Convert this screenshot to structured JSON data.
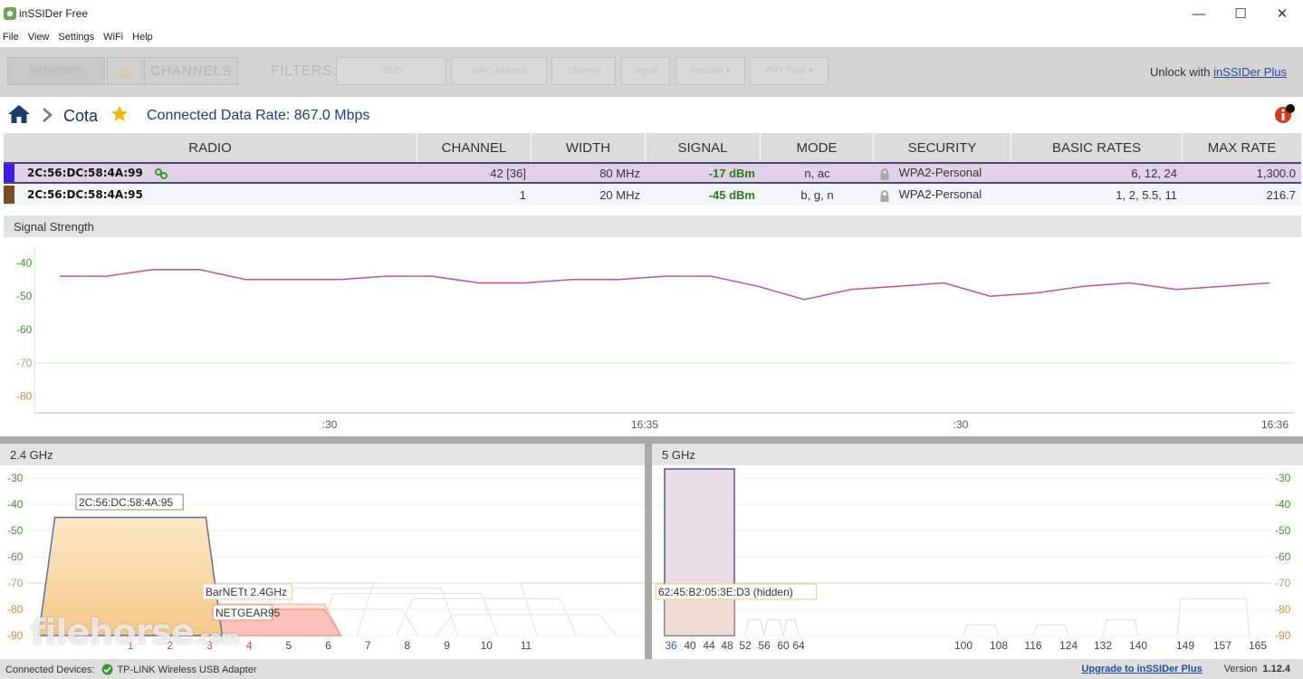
{
  "app": {
    "title": "inSSIDer Free",
    "window_controls": {
      "minimize": "—",
      "maximize": "☐",
      "close": "✕"
    }
  },
  "menu": [
    "File",
    "View",
    "Settings",
    "WiFi",
    "Help"
  ],
  "toolbar": {
    "networks_label": "NETWORKS",
    "channels_label": "CHANNELS",
    "filters_label": "FILTERS:",
    "filters": [
      "SSID",
      "MAC address",
      "Channel",
      "Signal",
      "Security ▾",
      "PHY Type ▾"
    ],
    "unlock_prefix": "Unlock with",
    "unlock_link": "inSSIDer Plus"
  },
  "breadcrumb": {
    "network": "Cota",
    "connected_rate": "Connected Data Rate: 867.0 Mbps"
  },
  "table": {
    "headers": [
      "RADIO",
      "CHANNEL",
      "WIDTH",
      "SIGNAL",
      "MODE",
      "SECURITY",
      "BASIC RATES",
      "MAX RATE"
    ],
    "rows": [
      {
        "color": "#3b1fe6",
        "radio": "2C:56:DC:58:4A:99",
        "channel": "42 [36]",
        "width": "80 MHz",
        "signal": "-17 dBm",
        "mode": "n, ac",
        "security": "WPA2-Personal",
        "basic_rates": "6, 12, 24",
        "max_rate": "1,300.0"
      },
      {
        "color": "#7a4a22",
        "radio": "2C:56:DC:58:4A:95",
        "channel": "1",
        "width": "20 MHz",
        "signal": "-45 dBm",
        "mode": "b, g, n",
        "security": "WPA2-Personal",
        "basic_rates": "1, 2, 5.5, 11",
        "max_rate": "216.7"
      }
    ]
  },
  "signal_strength": {
    "title": "Signal Strength",
    "y_ticks": [
      "-40",
      "-50",
      "-60",
      "-70",
      "-80"
    ],
    "x_ticks": [
      ":30",
      "16:35",
      ":30",
      "16:36"
    ],
    "line_color": "#c2528e",
    "series": [
      -44,
      -44,
      -42,
      -42,
      -45,
      -45,
      -45,
      -44,
      -44,
      -46,
      -46,
      -45,
      -45,
      -44,
      -44,
      -47,
      -51,
      -48,
      -47,
      -46,
      -50,
      -49,
      -47,
      -46,
      -48,
      -47,
      -46
    ]
  },
  "band_24": {
    "title": "2.4 GHz",
    "y_ticks": [
      "-30",
      "-40",
      "-50",
      "-60",
      "-70",
      "-80",
      "-90"
    ],
    "channels": [
      "1",
      "2",
      "3",
      "4",
      "5",
      "6",
      "7",
      "8",
      "9",
      "10",
      "11"
    ],
    "networks": [
      {
        "label": "2C:56:DC:58:4A:95",
        "channel": 1,
        "signal": -45,
        "fill": "#fbe6c0",
        "stroke": "#5f6f9a"
      },
      {
        "label": "BarNETt 2.4GHz",
        "channel": 4,
        "signal": -78,
        "fill": "#fde4d0",
        "stroke": "#e8b4a4"
      },
      {
        "label": "NETGEAR95",
        "channel": 4,
        "signal": -80,
        "fill": "#f9c0b8",
        "stroke": "#ee8a80"
      }
    ]
  },
  "band_5": {
    "title": "5 GHz",
    "y_ticks": [
      "-30",
      "-40",
      "-50",
      "-60",
      "-70",
      "-80",
      "-90"
    ],
    "channels": [
      "36",
      "40",
      "44",
      "48",
      "52",
      "56",
      "60",
      "64",
      "100",
      "108",
      "116",
      "124",
      "132",
      "140",
      "149",
      "157",
      "165"
    ],
    "networks": [
      {
        "label": "62:45:B2:05:3E:D3 (hidden)",
        "channel": 42,
        "signal": -30,
        "fill": "#eadce6",
        "stroke": "#4b5d9a"
      }
    ]
  },
  "status": {
    "connected_devices_label": "Connected Devices:",
    "device": "TP-LINK Wireless USB Adapter",
    "upgrade_link": "Upgrade to inSSIDer Plus",
    "version_label": "Version",
    "version": "1.12.4"
  },
  "watermark": {
    "main": "filehorse",
    "suffix": ".com"
  }
}
